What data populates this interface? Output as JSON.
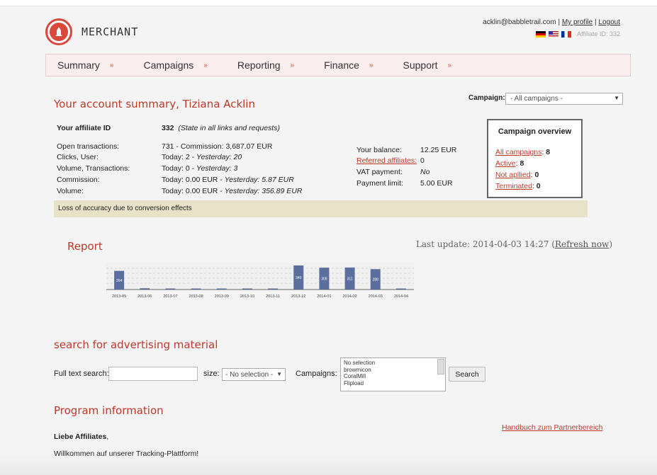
{
  "header": {
    "brand": "MERCHANT",
    "email": "acklin@babbletrail.com",
    "sep1": "|",
    "my_profile": "My profile",
    "sep2": "|",
    "logout": "Logout",
    "affiliate_id_label": "Affiliate ID: 332",
    "flags": [
      "german-flag-icon",
      "us-flag-icon",
      "french-flag-icon"
    ]
  },
  "nav": {
    "items": [
      {
        "label": "Summary"
      },
      {
        "label": "Campaigns"
      },
      {
        "label": "Reporting"
      },
      {
        "label": "Finance"
      },
      {
        "label": "Support"
      }
    ],
    "chevron": "»"
  },
  "summary": {
    "title": "Your account summary, Tiziana Acklin",
    "campaign_label": "Campaign:",
    "campaign_value": "- All campaigns -",
    "affiliate_id_label": "Your affiliate ID",
    "affiliate_id_value": "332",
    "affiliate_id_note": "(State in all links and requests)",
    "rows": [
      {
        "label": "Open transactions:",
        "value": "731  -  Commission: 3,687.07 EUR"
      },
      {
        "label": "Clicks, User:",
        "today": "Today: 2  -  ",
        "yesterday": "Yesterday: 20"
      },
      {
        "label": "Volume, Transactions:",
        "today": "Today: 0  -  ",
        "yesterday": "Yesterday: 3"
      },
      {
        "label": "Commission:",
        "today": "Today: 0.00 EUR  -  ",
        "yesterday": "Yesterday: 5.87 EUR"
      },
      {
        "label": "Volume:",
        "today": "Today: 0.00 EUR  -  ",
        "yesterday": "Yesterday: 356.89 EUR"
      }
    ],
    "balance": [
      {
        "label": "Your balance:",
        "value": "12.25 EUR"
      },
      {
        "label": "Referred affiliates:",
        "value": "0"
      },
      {
        "label": "VAT payment:",
        "value": "No"
      },
      {
        "label": "Payment limit:",
        "value": "5.00 EUR"
      }
    ],
    "notice": "Loss of accuracy due to conversion effects"
  },
  "overview": {
    "title": "Campaign overview",
    "rows": [
      {
        "label": "All campaigns",
        "value": "8"
      },
      {
        "label": "Active",
        "value": "8"
      },
      {
        "label": "Not apllied",
        "value": "0"
      },
      {
        "label": "Terminated",
        "value": "0"
      }
    ]
  },
  "report": {
    "title": "Report",
    "last_update": "Last update: 2014-04-03 14:27 (",
    "refresh": "Refresh now",
    "close_paren": ")"
  },
  "chart_data": {
    "type": "bar",
    "categories": [
      "2013-05",
      "2013-06",
      "2013-07",
      "2013-08",
      "2013-09",
      "2013-10",
      "2013-11",
      "2013-12",
      "2014-01",
      "2014-02",
      "2014-03",
      "2014-04"
    ],
    "values": [
      264,
      18,
      6,
      14,
      4,
      10,
      2,
      340,
      309,
      311,
      288,
      12
    ],
    "data_labels": [
      "264",
      "",
      "",
      "",
      "",
      "",
      "",
      "340",
      "309",
      "311",
      "288",
      ""
    ],
    "ylim": [
      0,
      380
    ],
    "grid": true,
    "color": "#5b6f9e"
  },
  "search": {
    "title": "search for advertising material",
    "fulltext_label": "Full text search:",
    "fulltext_value": "",
    "size_label": "size:",
    "size_value": "- No selection -",
    "campaigns_label": "Campaigns:",
    "campaign_options": [
      "No selection",
      "browmicon",
      "CoralMill",
      "Flipload"
    ],
    "search_button": "Search"
  },
  "program": {
    "title": "Program information",
    "handbuch": "Handbuch zum Partnerbereich",
    "greeting": "Liebe Affiliates",
    "greeting_comma": ",",
    "welcome": "Willkommen auf unserer Tracking-Plattform!"
  },
  "colors": {
    "accent": "#c0392b",
    "nav_bg": "#fbeeee",
    "notice_bg": "#e7e2c8"
  }
}
